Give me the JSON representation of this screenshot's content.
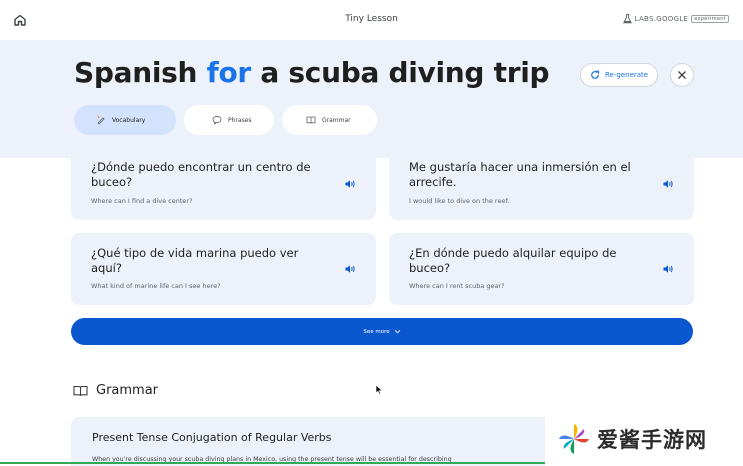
{
  "topbar": {
    "home_icon": "home-icon",
    "title": "Tiny Lesson",
    "labs_text": "LABS.GOOGLE",
    "labs_badge": "experiment"
  },
  "header": {
    "title_part1": "Spanish",
    "title_highlight": "for",
    "title_part2": "a scuba diving trip",
    "regenerate_label": "Re-generate",
    "accent_color": "#1a73e8",
    "header_bg": "#edf1f9"
  },
  "tabs": [
    {
      "label": "Vocabulary",
      "icon": "vocabulary-icon",
      "active": true
    },
    {
      "label": "Phrases",
      "icon": "phrases-icon",
      "active": false
    },
    {
      "label": "Grammar",
      "icon": "grammar-icon",
      "active": false
    }
  ],
  "phrases": [
    {
      "spanish": "¿Dónde puedo encontrar un centro de buceo?",
      "english": "Where can I find a dive center?"
    },
    {
      "spanish": "Me gustaría hacer una inmersión en el arrecife.",
      "english": "I would like to dive on the reef."
    },
    {
      "spanish": "¿Qué tipo de vida marina puedo ver aquí?",
      "english": "What kind of marine life can I see here?"
    },
    {
      "spanish": "¿En dónde puedo alquilar equipo de buceo?",
      "english": "Where can I rent scuba gear?"
    }
  ],
  "see_more_label": "See more",
  "grammar": {
    "section_label": "Grammar",
    "card_title": "Present Tense Conjugation of Regular Verbs",
    "card_body": "When you're discussing your scuba diving plans in Mexico, using the present tense will be essential for describing"
  },
  "watermark": {
    "text": "爱酱手游网"
  },
  "colors": {
    "primary_button": "#0b57d0",
    "card_bg": "#edf2fa",
    "active_tab": "#d3e3fd"
  }
}
